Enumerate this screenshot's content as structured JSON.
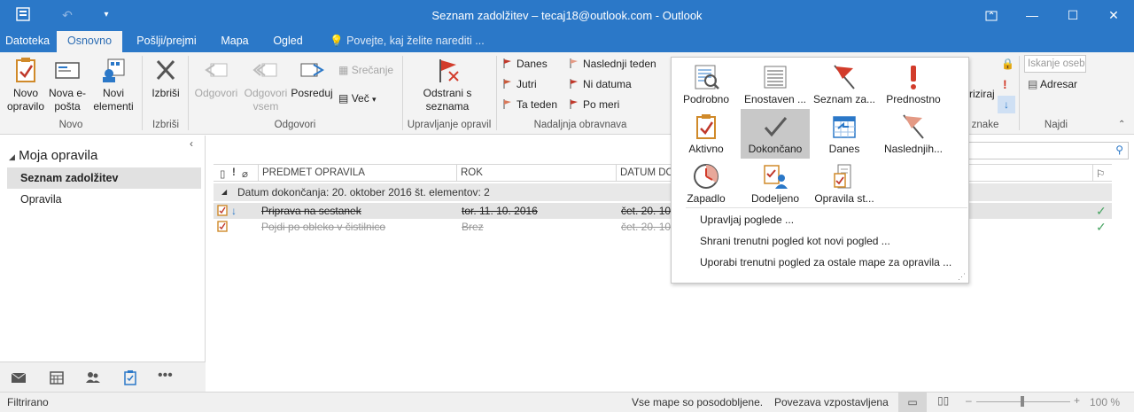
{
  "window": {
    "title": "Seznam zadolžitev – tecaj18@outlook.com - Outlook"
  },
  "tabs": [
    {
      "label": "Datoteka"
    },
    {
      "label": "Osnovno"
    },
    {
      "label": "Pošlji/prejmi"
    },
    {
      "label": "Mapa"
    },
    {
      "label": "Ogled"
    }
  ],
  "tell_me": "Povejte, kaj želite narediti ...",
  "ribbon": {
    "new_task": "Novo opravilo",
    "new_email": "Nova e-pošta",
    "new_items": "Novi elementi",
    "delete": "Izbriši",
    "reply": "Odgovori",
    "reply_all": "Odgovori vsem",
    "forward": "Posreduj",
    "meeting": "Srečanje",
    "more": "Več",
    "remove_from_list": "Odstrani s seznama",
    "today": "Danes",
    "tomorrow": "Jutri",
    "this_week": "Ta teden",
    "next_week": "Naslednji teden",
    "no_date": "Ni datuma",
    "custom": "Po meri",
    "prioritize": "riziraj",
    "address_book": "Adresar",
    "search_people_placeholder": "Iskanje oseb",
    "groups": {
      "new": "Novo",
      "delete": "Izbriši",
      "respond": "Odgovori",
      "manage": "Upravljanje opravil",
      "followup": "Nadaljnja obravnava",
      "tags": "znake",
      "find": "Najdi"
    }
  },
  "nav": {
    "header": "Moja opravila",
    "items": [
      {
        "label": "Seznam zadolžitev"
      },
      {
        "label": "Opravila"
      }
    ]
  },
  "list": {
    "columns": {
      "subject": "PREDMET OPRAVILA",
      "due": "ROK",
      "completed": "DATUM DO"
    },
    "group_label": "Datum dokončanja: 20. oktober 2016 št. elementov: 2",
    "tasks": [
      {
        "subject": "Priprava na sestanek",
        "due": "tor. 11. 10. 2016",
        "completed": "čet. 20. 10."
      },
      {
        "subject": "Pojdi po obleko v čistilnico",
        "due": "Brez",
        "completed": "čet. 20. 10."
      }
    ]
  },
  "views_popup": {
    "views": [
      {
        "label": "Podrobno",
        "icon": "detailed-view-icon"
      },
      {
        "label": "Enostaven ...",
        "icon": "simple-list-icon"
      },
      {
        "label": "Seznam za...",
        "icon": "todo-list-flag-icon"
      },
      {
        "label": "Prednostno",
        "icon": "prioritized-icon"
      },
      {
        "label": "Aktivno",
        "icon": "active-icon"
      },
      {
        "label": "Dokončano",
        "icon": "completed-check-icon"
      },
      {
        "label": "Danes",
        "icon": "today-calendar-icon"
      },
      {
        "label": "Naslednjih...",
        "icon": "next-days-flag-icon"
      },
      {
        "label": "Zapadlo",
        "icon": "overdue-clock-icon"
      },
      {
        "label": "Dodeljeno",
        "icon": "assigned-icon"
      },
      {
        "label": "Opravila st...",
        "icon": "server-tasks-icon"
      }
    ],
    "selected": "Dokončano",
    "menu": [
      {
        "label": "Upravljaj poglede ..."
      },
      {
        "label": "Shrani trenutni pogled kot novi pogled ..."
      },
      {
        "label": "Uporabi trenutni pogled za ostale mape za opravila ..."
      }
    ]
  },
  "status": {
    "left": "Filtrirano",
    "sync": "Vse mape so posodobljene.",
    "connection": "Povezava vzpostavljena",
    "zoom": "100 %"
  }
}
